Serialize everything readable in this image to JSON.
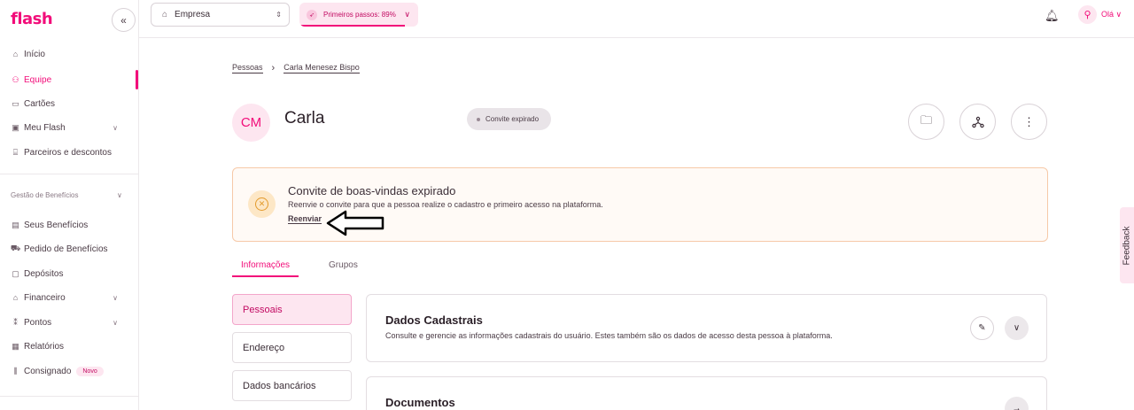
{
  "brand": {
    "logo": "flash",
    "accent": "#f20d7a"
  },
  "sidebar": {
    "collapse_label": "«",
    "items": [
      {
        "label": "Início",
        "icon": "home-icon"
      },
      {
        "label": "Equipe",
        "icon": "people-icon",
        "active": true
      },
      {
        "label": "Cartões",
        "icon": "card-icon"
      },
      {
        "label": "Meu Flash",
        "icon": "wallet-icon",
        "expandable": true
      },
      {
        "label": "Parceiros e descontos",
        "icon": "store-icon"
      }
    ],
    "section_label": "Gestão de Benefícios",
    "benefit_items": [
      {
        "label": "Seus Benefícios",
        "icon": "gift-icon"
      },
      {
        "label": "Pedido de Benefícios",
        "icon": "cart-icon"
      },
      {
        "label": "Depósitos",
        "icon": "deposit-icon"
      },
      {
        "label": "Financeiro",
        "icon": "bank-icon",
        "expandable": true
      },
      {
        "label": "Pontos",
        "icon": "points-icon",
        "expandable": true
      },
      {
        "label": "Relatórios",
        "icon": "report-icon"
      },
      {
        "label": "Consignado",
        "icon": "loan-icon",
        "badge": "Novo"
      }
    ]
  },
  "topbar": {
    "company": "Empresa",
    "steps_label": "Primeiros passos: 89%",
    "steps_progress": 0.89,
    "user_greeting": "Olá"
  },
  "breadcrumb": {
    "root": "Pessoas",
    "current": "Carla Menesez Bispo"
  },
  "profile": {
    "initials": "CM",
    "name": "Carla",
    "status": "Convite expirado"
  },
  "alert": {
    "title": "Convite de boas-vindas expirado",
    "description": "Reenvie o convite para que a pessoa realize o cadastro e primeiro acesso na plataforma.",
    "action": "Reenviar"
  },
  "tabs": [
    {
      "label": "Informações",
      "active": true
    },
    {
      "label": "Grupos"
    }
  ],
  "side_menu": [
    {
      "label": "Pessoais",
      "active": true
    },
    {
      "label": "Endereço"
    },
    {
      "label": "Dados bancários"
    }
  ],
  "cards": [
    {
      "title": "Dados Cadastrais",
      "description": "Consulte e gerencie as informações cadastrais do usuário. Estes também são os dados de acesso desta pessoa à plataforma."
    },
    {
      "title": "Documentos"
    }
  ],
  "feedback_label": "Feedback"
}
